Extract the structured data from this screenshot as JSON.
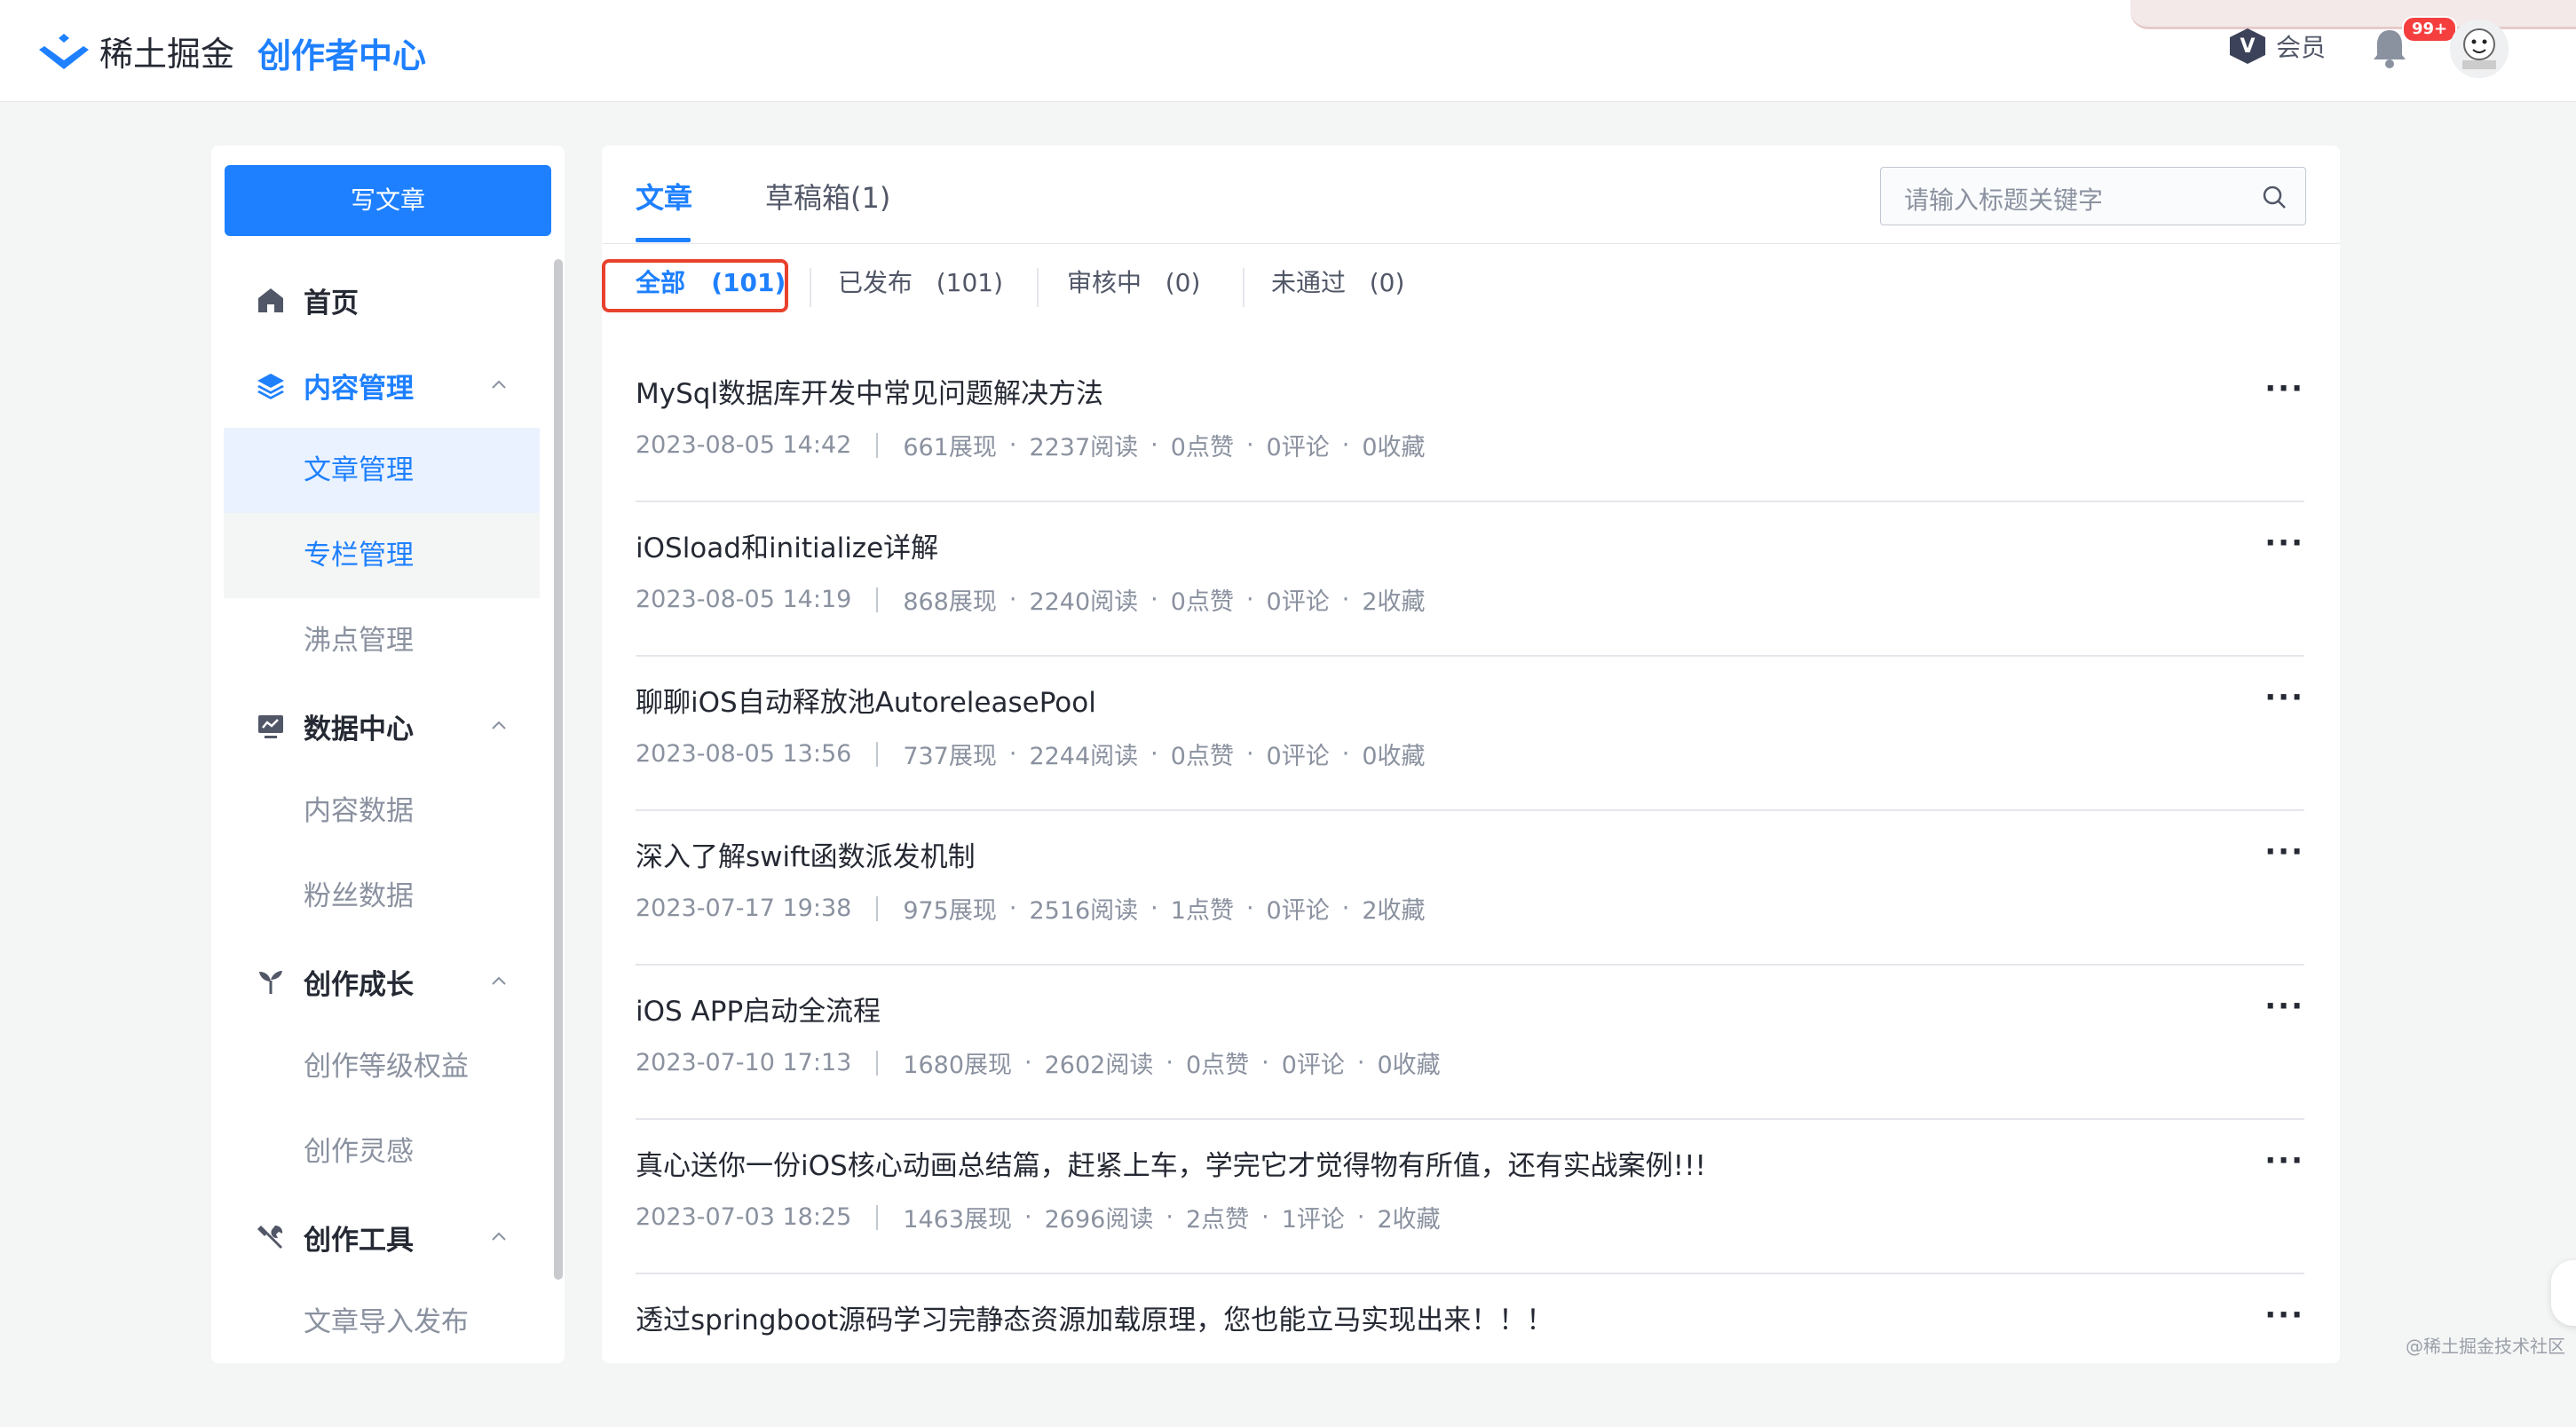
{
  "header": {
    "logo_text": "稀土掘金",
    "subtitle": "创作者中心",
    "vip_label": "会员",
    "notification_badge": "99+",
    "accent_color": "#1e80ff"
  },
  "sidebar": {
    "write_button": "写文章",
    "nav": [
      {
        "label": "首页",
        "icon": "home-icon"
      },
      {
        "label": "内容管理",
        "icon": "layers-icon",
        "expanded": true
      },
      {
        "label": "文章管理",
        "state": "active"
      },
      {
        "label": "专栏管理",
        "state": "hover"
      },
      {
        "label": "沸点管理"
      },
      {
        "label": "数据中心",
        "icon": "chart-icon",
        "expanded": true
      },
      {
        "label": "内容数据"
      },
      {
        "label": "粉丝数据"
      },
      {
        "label": "创作成长",
        "icon": "sprout-icon",
        "expanded": true
      },
      {
        "label": "创作等级权益"
      },
      {
        "label": "创作灵感"
      },
      {
        "label": "创作工具",
        "icon": "tools-icon",
        "expanded": true
      },
      {
        "label": "文章导入发布"
      }
    ]
  },
  "main": {
    "tabs": [
      "文章",
      "草稿箱(1)"
    ],
    "search_placeholder": "请输入标题关键字",
    "filters": [
      {
        "label": "全部",
        "count": "(101)"
      },
      {
        "label": "已发布",
        "count": "(101)"
      },
      {
        "label": "审核中",
        "count": "(0)"
      },
      {
        "label": "未通过",
        "count": "(0)"
      }
    ],
    "articles": [
      {
        "title": "MySql数据库开发中常见问题解决方法",
        "date": "2023-08-05 14:42",
        "views": "661展现",
        "reads": "2237阅读",
        "likes": "0点赞",
        "comments": "0评论",
        "favorites": "0收藏"
      },
      {
        "title": "iOSload和initialize详解",
        "date": "2023-08-05 14:19",
        "views": "868展现",
        "reads": "2240阅读",
        "likes": "0点赞",
        "comments": "0评论",
        "favorites": "2收藏"
      },
      {
        "title": "聊聊iOS自动释放池AutoreleasePool",
        "date": "2023-08-05 13:56",
        "views": "737展现",
        "reads": "2244阅读",
        "likes": "0点赞",
        "comments": "0评论",
        "favorites": "0收藏"
      },
      {
        "title": "深入了解swift函数派发机制",
        "date": "2023-07-17 19:38",
        "views": "975展现",
        "reads": "2516阅读",
        "likes": "1点赞",
        "comments": "0评论",
        "favorites": "2收藏"
      },
      {
        "title": "iOS APP启动全流程",
        "date": "2023-07-10 17:13",
        "views": "1680展现",
        "reads": "2602阅读",
        "likes": "0点赞",
        "comments": "0评论",
        "favorites": "0收藏"
      },
      {
        "title": "真心送你一份iOS核心动画总结篇，赶紧上车，学完它才觉得物有所值，还有实战案例!!!",
        "date": "2023-07-03 18:25",
        "views": "1463展现",
        "reads": "2696阅读",
        "likes": "2点赞",
        "comments": "1评论",
        "favorites": "2收藏"
      },
      {
        "title": "透过springboot源码学习完静态资源加载原理，您也能立马实现出来！！！",
        "date": "",
        "views": "",
        "reads": "",
        "likes": "",
        "comments": "",
        "favorites": ""
      }
    ],
    "more_label": "···"
  },
  "watermark": "@稀土掘金技术社区"
}
